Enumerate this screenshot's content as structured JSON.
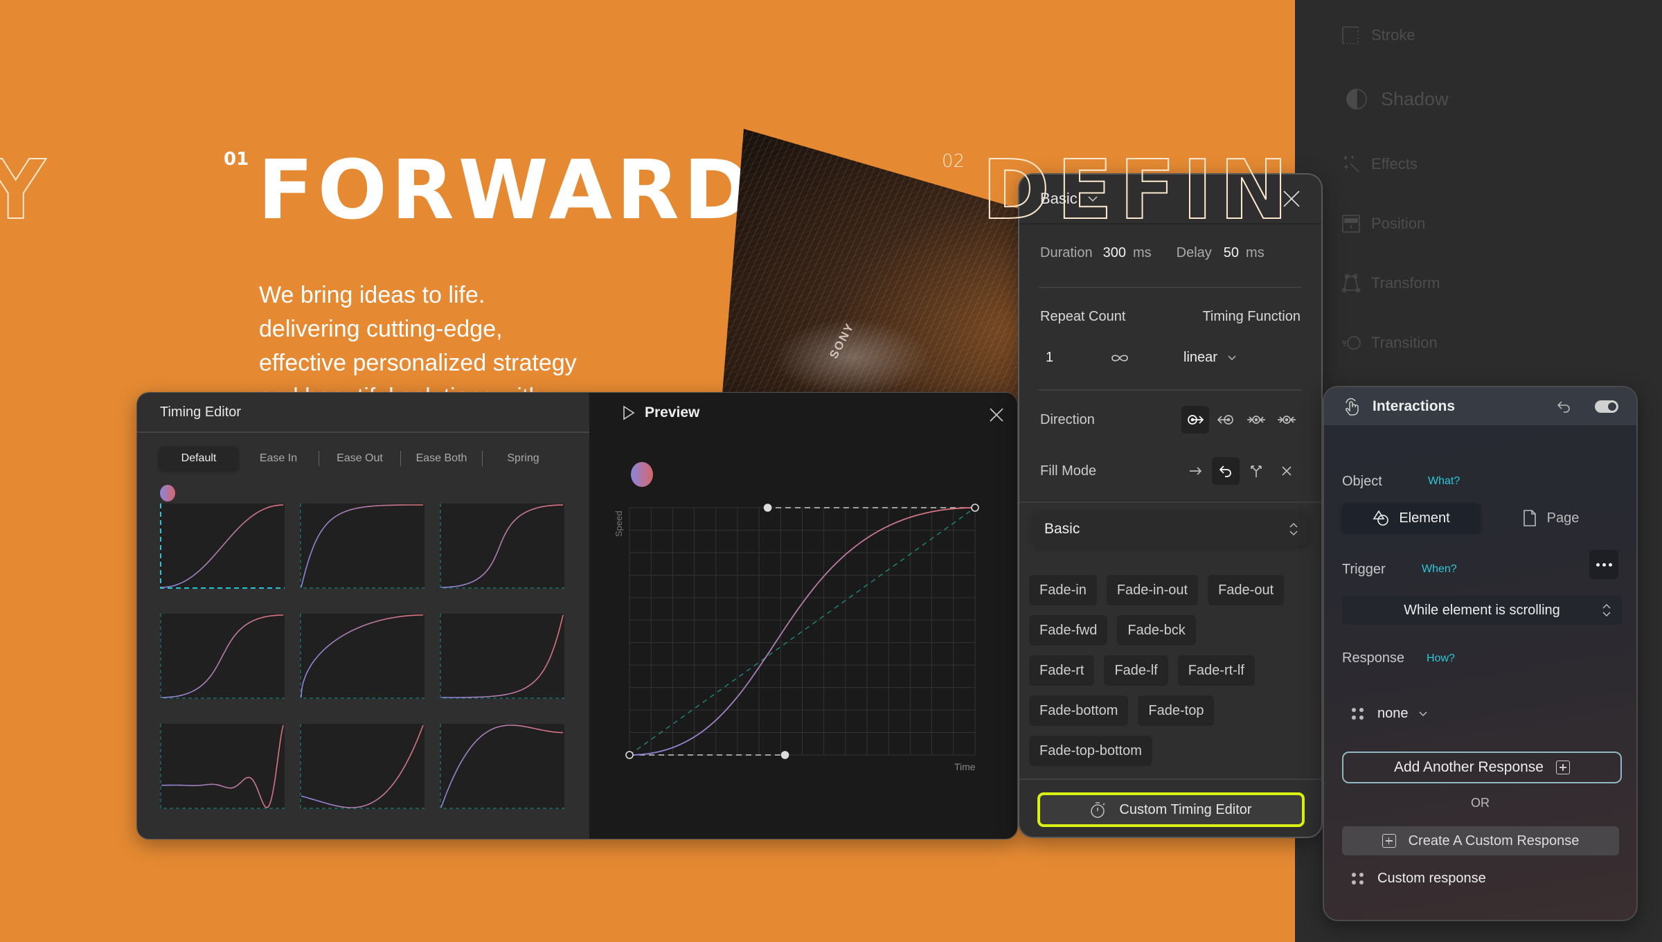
{
  "hero": {
    "prev_word_fragment": "Y",
    "section_number": "01",
    "title": "FORWARD",
    "next_section_number": "02",
    "next_word_fragment": "DEFINE",
    "copy_lines": [
      "We bring ideas to life.",
      "delivering cutting-edge,",
      "effective personalized strategy",
      "and beautiful solutions with"
    ],
    "photo_brand_text": "SONY"
  },
  "sidebar": {
    "items": [
      {
        "label": "Stroke",
        "icon": "stroke-icon"
      },
      {
        "label": "Shadow",
        "icon": "shadow-icon"
      },
      {
        "label": "Effects",
        "icon": "effects-wand-icon"
      },
      {
        "label": "Position",
        "icon": "position-icon"
      },
      {
        "label": "Transform",
        "icon": "transform-icon"
      },
      {
        "label": "Transition",
        "icon": "transition-icon"
      }
    ]
  },
  "timing_editor": {
    "title": "Timing Editor",
    "tabs": [
      "Default",
      "Ease In",
      "Ease Out",
      "Ease Both",
      "Spring"
    ],
    "active_tab": "Default",
    "presets": [
      {
        "name": "ease-default",
        "bezier": [
          0.42,
          0,
          0.58,
          1
        ]
      },
      {
        "name": "ease-out-expo",
        "bezier": [
          0.16,
          1,
          0.3,
          1
        ]
      },
      {
        "name": "ease-in-out-steep",
        "bezier": [
          0.7,
          0,
          0.25,
          1
        ]
      },
      {
        "name": "ease-in-out-cubic",
        "bezier": [
          0.65,
          0,
          0.35,
          1
        ]
      },
      {
        "name": "ease-out-circ",
        "bezier": [
          0.0,
          0.55,
          0.45,
          1
        ]
      },
      {
        "name": "ease-in-expo",
        "bezier": [
          0.7,
          0,
          0.84,
          0
        ]
      },
      {
        "name": "elastic-in",
        "type": "elastic"
      },
      {
        "name": "back-in",
        "bezier": [
          0.36,
          -0.15,
          0.66,
          -0.56
        ]
      },
      {
        "name": "back-out",
        "bezier": [
          0.34,
          1.56,
          0.64,
          1
        ]
      }
    ],
    "selected_preset": 0
  },
  "preview": {
    "title": "Preview",
    "y_axis_label": "Speed",
    "x_axis_label": "Time",
    "bezier": [
      0.45,
      0,
      0.4,
      1
    ]
  },
  "basic_panel": {
    "title": "Basic",
    "duration_label": "Duration",
    "duration_value": "300",
    "duration_unit": "ms",
    "delay_label": "Delay",
    "delay_value": "50",
    "delay_unit": "ms",
    "repeat_label": "Repeat Count",
    "repeat_value": "1",
    "timing_label": "Timing Function",
    "timing_value": "linear",
    "direction_label": "Direction",
    "direction_options": [
      "normal",
      "reverse",
      "alternate",
      "alternate-reverse"
    ],
    "direction_selected": "normal",
    "fill_label": "Fill Mode",
    "fill_options": [
      "forwards",
      "backwards",
      "both",
      "none"
    ],
    "fill_selected": "backwards",
    "category_select": "Basic",
    "presets": [
      "Fade-in",
      "Fade-in-out",
      "Fade-out",
      "Fade-fwd",
      "Fade-bck",
      "Fade-rt",
      "Fade-lf",
      "Fade-rt-lf",
      "Fade-bottom",
      "Fade-top",
      "Fade-top-bottom"
    ],
    "custom_timing_button": "Custom Timing Editor",
    "accent_color": "#D8F012"
  },
  "interactions": {
    "title": "Interactions",
    "enabled": true,
    "object_label": "Object",
    "object_hint": "What?",
    "object_options": [
      "Element",
      "Page"
    ],
    "object_selected": "Element",
    "trigger_label": "Trigger",
    "trigger_hint": "When?",
    "trigger_value": "While element is scrolling",
    "response_label": "Response",
    "response_hint": "How?",
    "response_value": "none",
    "add_response_button": "Add Another Response",
    "or_label": "OR",
    "create_custom_button": "Create A Custom Response",
    "custom_response_item": "Custom response",
    "hint_color": "#2CC8D8"
  }
}
